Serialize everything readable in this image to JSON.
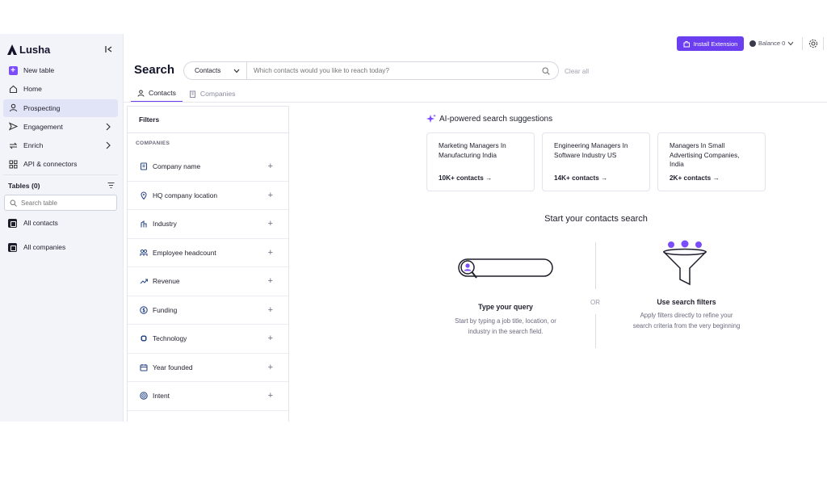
{
  "brand": {
    "name": "Lusha"
  },
  "sidebar": {
    "items": [
      {
        "label": "New table"
      },
      {
        "label": "Home"
      },
      {
        "label": "Prospecting"
      },
      {
        "label": "Engagement"
      },
      {
        "label": "Enrich"
      },
      {
        "label": "API & connectors"
      }
    ],
    "tables_label": "Tables (0)",
    "search_placeholder": "Search table",
    "tables": [
      {
        "label": "All contacts"
      },
      {
        "label": "All companies"
      }
    ]
  },
  "topbar": {
    "install_label": "Install Extension",
    "balance_label": "Balance 0"
  },
  "search": {
    "title": "Search",
    "scope": "Contacts",
    "placeholder": "Which contacts would you like to reach today?",
    "clear_label": "Clear all"
  },
  "tabs": [
    {
      "label": "Contacts"
    },
    {
      "label": "Companies"
    }
  ],
  "filters": {
    "title": "Filters",
    "group": "COMPANIES",
    "items": [
      {
        "label": "Company name"
      },
      {
        "label": "HQ company location"
      },
      {
        "label": "Industry"
      },
      {
        "label": "Employee headcount"
      },
      {
        "label": "Revenue"
      },
      {
        "label": "Funding"
      },
      {
        "label": "Technology"
      },
      {
        "label": "Year founded"
      },
      {
        "label": "Intent"
      }
    ]
  },
  "suggestions": {
    "title": "AI-powered search suggestions",
    "cards": [
      {
        "text": "Marketing Managers In Manufacturing India",
        "count": "10K+ contacts →"
      },
      {
        "text": "Engineering Managers In Software Industry US",
        "count": "14K+ contacts →"
      },
      {
        "text": "Managers In Small Advertising Companies, India",
        "count": "2K+ contacts →"
      }
    ]
  },
  "start": {
    "title": "Start your contacts search",
    "or_label": "OR",
    "query_title": "Type your query",
    "query_desc": "Start by typing a job title, location, or industry in the search field.",
    "filters_title": "Use search filters",
    "filters_desc": "Apply filters directly to refine your search criteria from the very beginning"
  },
  "colors": {
    "accent": "#6b3ff0",
    "sidebar_bg": "#f3f4fa",
    "active_bg": "#e1e3f6"
  }
}
